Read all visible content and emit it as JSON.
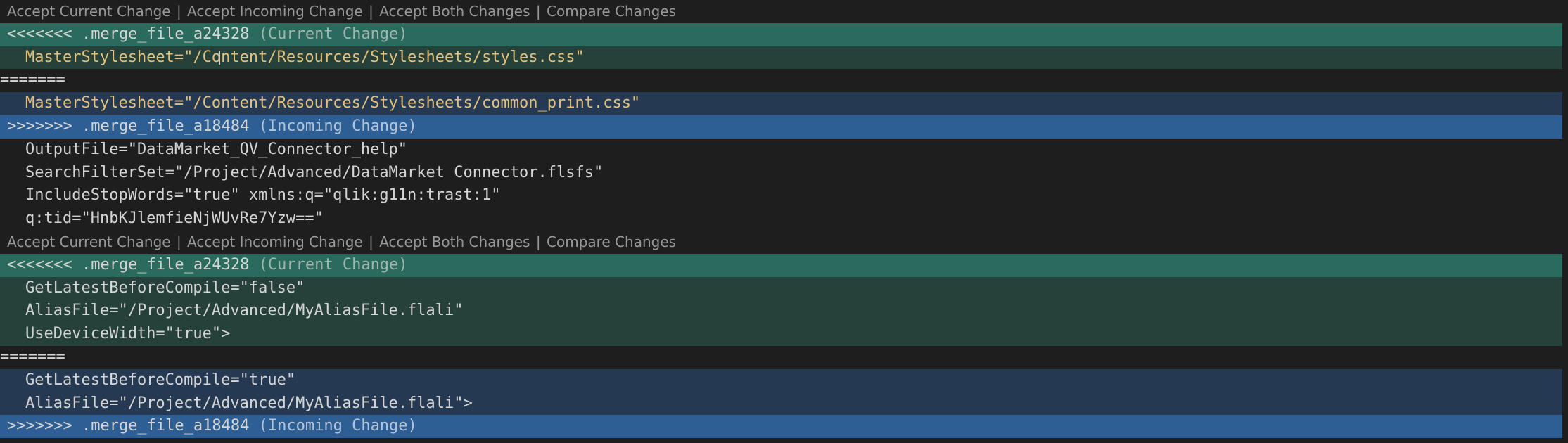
{
  "codelens": {
    "accept_current": "Accept Current Change",
    "accept_incoming": "Accept Incoming Change",
    "accept_both": "Accept Both Changes",
    "compare": "Compare Changes",
    "separator": "|"
  },
  "conflict1": {
    "current_marker": "<<<<<<< .merge_file_a24328",
    "current_label": "(Current Change)",
    "current_lines": [
      "MasterStylesheet=\"/Content/Resources/Stylesheets/styles.css\""
    ],
    "divider": "=======",
    "incoming_lines": [
      "MasterStylesheet=\"/Content/Resources/Stylesheets/common_print.css\""
    ],
    "incoming_marker": ">>>>>>> .merge_file_a18484",
    "incoming_label": "(Incoming Change)"
  },
  "plain_lines": [
    "OutputFile=\"DataMarket_QV_Connector_help\"",
    "SearchFilterSet=\"/Project/Advanced/DataMarket Connector.flsfs\"",
    "IncludeStopWords=\"true\" xmlns:q=\"qlik:g11n:trast:1\"",
    "q:tid=\"HnbKJlemfieNjWUvRe7Yzw==\""
  ],
  "conflict2": {
    "current_marker": "<<<<<<< .merge_file_a24328",
    "current_label": "(Current Change)",
    "current_lines": [
      "GetLatestBeforeCompile=\"false\"",
      "AliasFile=\"/Project/Advanced/MyAliasFile.flali\"",
      "UseDeviceWidth=\"true\">"
    ],
    "divider": "=======",
    "incoming_lines": [
      "GetLatestBeforeCompile=\"true\"",
      "AliasFile=\"/Project/Advanced/MyAliasFile.flali\">"
    ],
    "incoming_marker": ">>>>>>> .merge_file_a18484",
    "incoming_label": "(Incoming Change)"
  },
  "colors": {
    "editor_bg": "#1e1e1e",
    "current_header_bg": "#2a6b5e",
    "current_body_bg": "#25413a",
    "incoming_header_bg": "#2e5f94",
    "incoming_body_bg": "#253a52",
    "highlight_text": "#e5c07b",
    "codelens_text": "#999999"
  }
}
